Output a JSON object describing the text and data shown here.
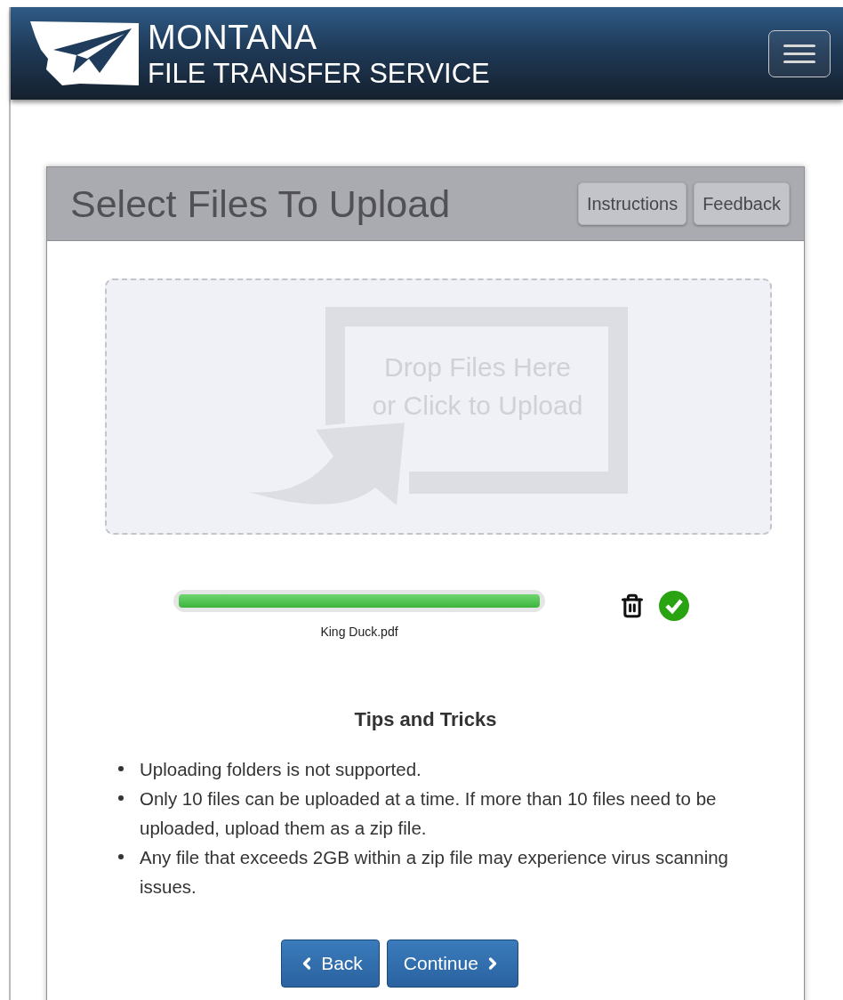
{
  "header": {
    "title": "MONTANA",
    "subtitle": "FILE TRANSFER SERVICE"
  },
  "panel": {
    "title": "Select Files To Upload",
    "actions": [
      "Instructions",
      "Feedback"
    ]
  },
  "drop_zone": {
    "prompt": [
      "Drop Files Here",
      "or Click to Upload"
    ]
  },
  "uploads": [
    {
      "file_name": "King Duck.pdf",
      "level": 1,
      "complete": true
    }
  ],
  "tips": {
    "title": "Tips and Tricks",
    "items": [
      "Uploading folders is not supported.",
      "Only 10 files can be uploaded at a time. If more than 10 files need to be uploaded, upload them as a zip file.",
      "Any file that exceeds 2GB within a zip file may experience virus scanning issues."
    ]
  },
  "buttons": [
    {
      "kind": "back",
      "label": "Back"
    },
    {
      "kind": "continue",
      "label": "Continue"
    }
  ]
}
